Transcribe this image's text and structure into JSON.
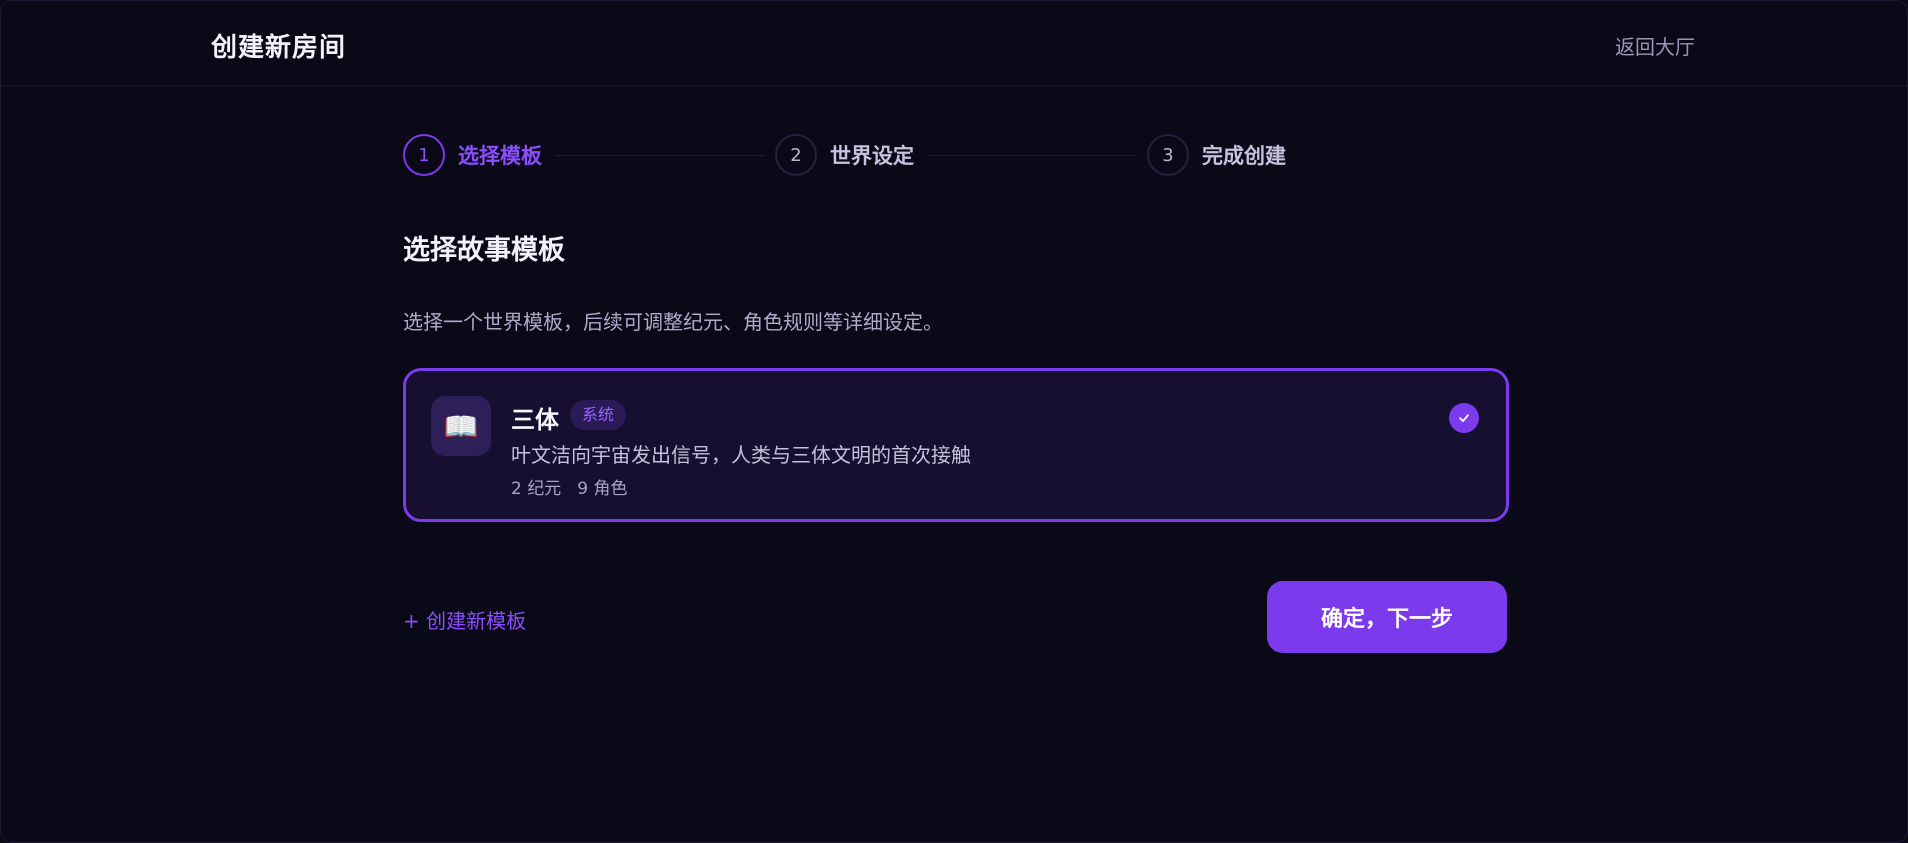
{
  "header": {
    "title": "创建新房间",
    "back_label": "返回大厅"
  },
  "stepper": {
    "steps": [
      {
        "number": "1",
        "label": "选择模板",
        "active": true
      },
      {
        "number": "2",
        "label": "世界设定",
        "active": false
      },
      {
        "number": "3",
        "label": "完成创建",
        "active": false
      }
    ]
  },
  "section": {
    "title": "选择故事模板",
    "description": "选择一个世界模板，后续可调整纪元、角色规则等详细设定。"
  },
  "templates": [
    {
      "icon": "open-book-icon",
      "icon_glyph": "📖",
      "name": "三体",
      "badge": "系统",
      "description": "叶文洁向宇宙发出信号，人类与三体文明的首次接触",
      "eras": "2 纪元",
      "roles": "9 角色",
      "selected": true
    }
  ],
  "actions": {
    "create_template_label": "+ 创建新模板",
    "next_label": "确定，下一步"
  },
  "colors": {
    "background": "#0a0918",
    "accent": "#7c3aed",
    "accent_text": "#8b4dff",
    "card_bg": "#160f30"
  }
}
